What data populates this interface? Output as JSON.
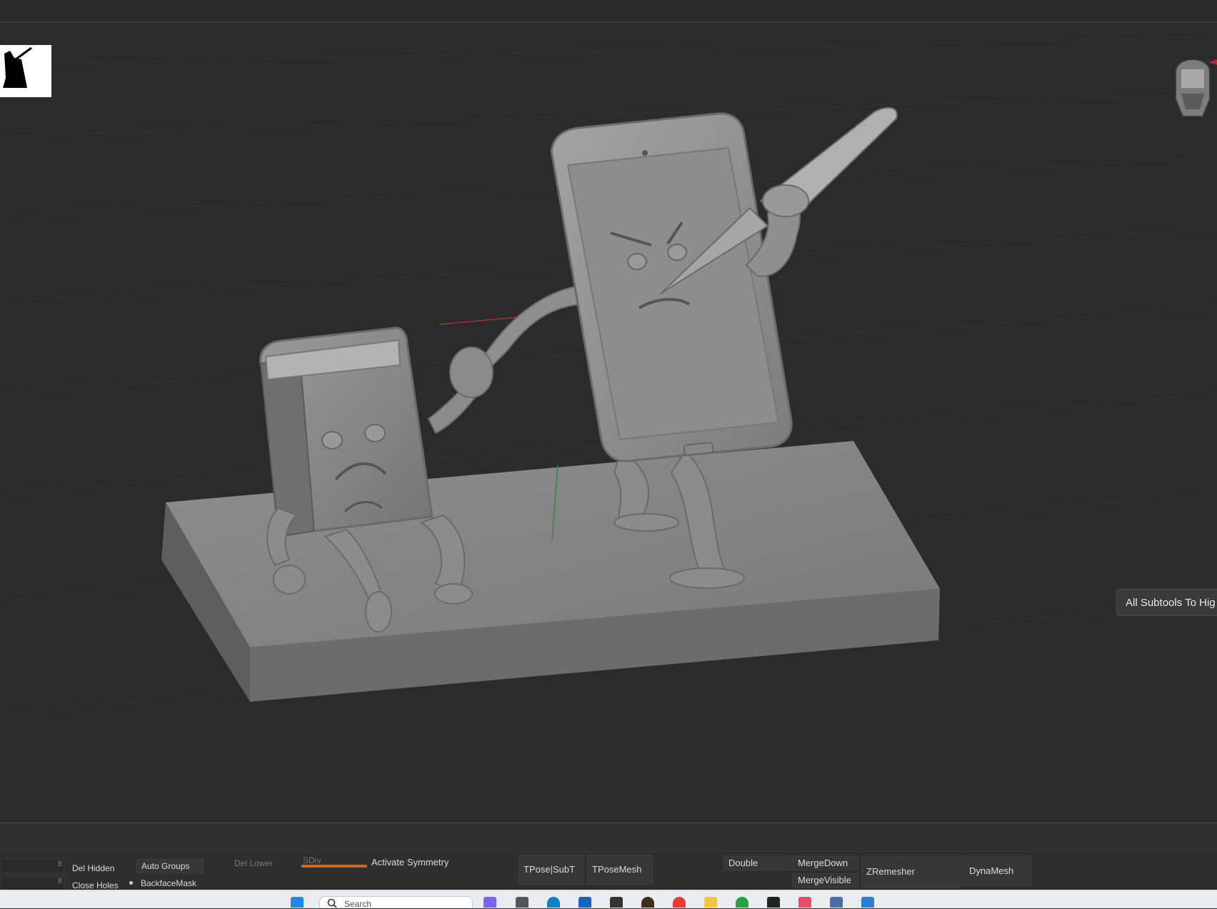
{
  "viewport": {
    "tooltip_text": "All Subtools To Hig"
  },
  "toolbar": {
    "del_hidden": "Del Hidden",
    "close_holes": "Close Holes",
    "auto_groups": "Auto Groups",
    "backface_mask": "BackfaceMask",
    "del_lower": "Del Lower",
    "sdiv": "SDiv",
    "activate_symmetry": "Activate Symmetry",
    "tpose_subt": "TPose|SubT",
    "tpose_mesh": "TPoseMesh",
    "double": "Double",
    "merge_down": "MergeDown",
    "merge_visible": "MergeVisible",
    "zremesher": "ZRemesher",
    "dynamesh": "DynaMesh"
  },
  "taskbar": {
    "search_placeholder": "Search",
    "icons": [
      "windows-start-icon",
      "copilot-icon",
      "task-view-icon",
      "edge-icon",
      "store-icon",
      "zbrush-icon",
      "app-icon",
      "chrome-icon",
      "file-explorer-icon",
      "whatsapp-icon",
      "terminal-icon",
      "snipping-tool-icon",
      "calculator-icon",
      "photos-icon"
    ]
  },
  "colors": {
    "accent": "#c96a25",
    "background": "#2b2b2b",
    "model": "#8a8a8a"
  }
}
